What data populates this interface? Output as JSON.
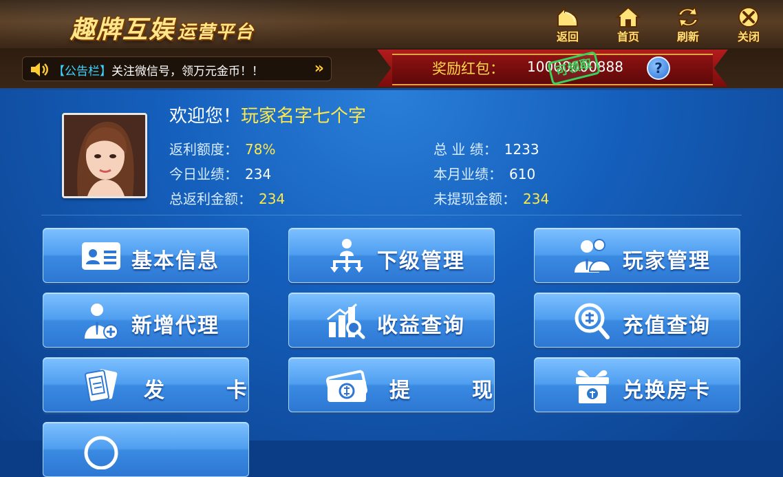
{
  "header": {
    "logo_main": "趣牌互娱",
    "logo_sub": "运营平台",
    "nav": [
      {
        "label": "返回",
        "icon": "back-arrow-icon"
      },
      {
        "label": "首页",
        "icon": "home-icon"
      },
      {
        "label": "刷新",
        "icon": "refresh-icon"
      },
      {
        "label": "关闭",
        "icon": "close-icon"
      }
    ]
  },
  "notice": {
    "tag": "【公告栏】",
    "text": "关注微信号，领万元金币！！",
    "more": "»"
  },
  "reward": {
    "label": "奖励红包：",
    "amount": "10000000888",
    "stamp": "可领取",
    "help": "?"
  },
  "profile": {
    "welcome": "欢迎您！",
    "player_name": "玩家名字七个字",
    "stats": {
      "rebate_rate_label": "返利额度：",
      "rebate_rate": "78%",
      "total_perf_label": "总 业 绩：",
      "total_perf": "1233",
      "today_perf_label": "今日业绩：",
      "today_perf": "234",
      "month_perf_label": "本月业绩：",
      "month_perf": "610",
      "total_rebate_label": "总返利金额：",
      "total_rebate": "234",
      "unwithdrawn_label": "未提现金额：",
      "unwithdrawn": "234"
    }
  },
  "menu": [
    {
      "label": "基本信息",
      "icon": "id-card-icon"
    },
    {
      "label": "下级管理",
      "icon": "org-chart-icon"
    },
    {
      "label": "玩家管理",
      "icon": "users-icon"
    },
    {
      "label": "新增代理",
      "icon": "add-agent-icon"
    },
    {
      "label": "收益查询",
      "icon": "chart-search-icon"
    },
    {
      "label": "充值查询",
      "icon": "recharge-search-icon"
    },
    {
      "label": "发　卡",
      "icon": "room-card-icon"
    },
    {
      "label": "提　现",
      "icon": "cash-icon"
    },
    {
      "label": "兑换房卡",
      "icon": "gift-exchange-icon"
    }
  ],
  "colors": {
    "accent_yellow": "#ffe94a",
    "button_blue": "#4f9ef0",
    "reward_red": "#8e1212",
    "stamp_green": "#3ad15a"
  }
}
